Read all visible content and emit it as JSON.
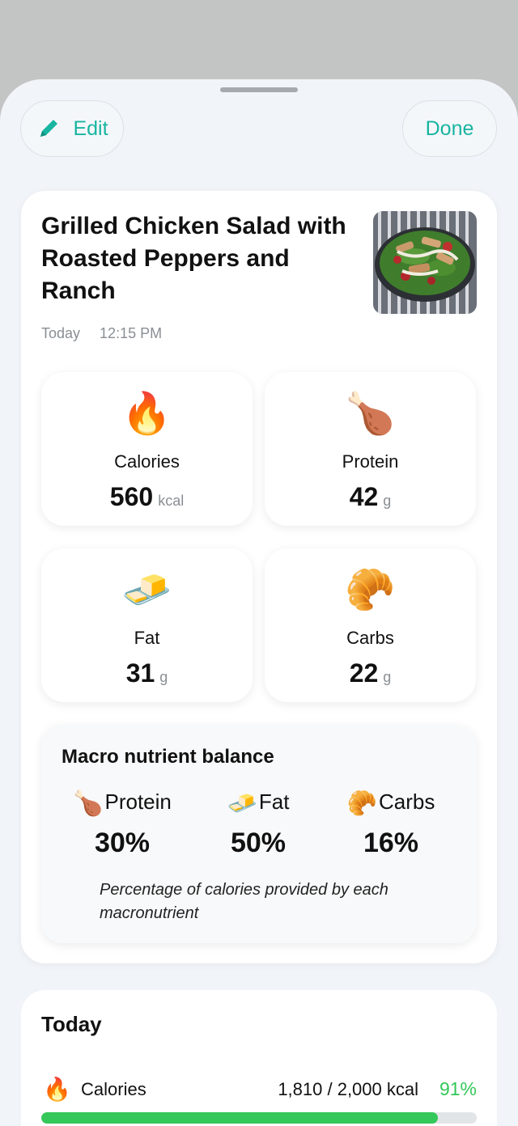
{
  "header": {
    "edit_label": "Edit",
    "done_label": "Done"
  },
  "meal": {
    "title": "Grilled Chicken Salad with Roasted Peppers and Ranch",
    "day": "Today",
    "time": "12:15 PM"
  },
  "stats": [
    {
      "icon": "fire-icon",
      "emoji": "🔥",
      "label": "Calories",
      "value": "560",
      "unit": "kcal"
    },
    {
      "icon": "poultry-leg-icon",
      "emoji": "🍗",
      "label": "Protein",
      "value": "42",
      "unit": "g"
    },
    {
      "icon": "butter-icon",
      "emoji": "🧈",
      "label": "Fat",
      "value": "31",
      "unit": "g"
    },
    {
      "icon": "croissant-icon",
      "emoji": "🥐",
      "label": "Carbs",
      "value": "22",
      "unit": "g"
    }
  ],
  "macro": {
    "title": "Macro nutrient balance",
    "items": [
      {
        "emoji": "🍗",
        "name": "Protein",
        "pct": "30%"
      },
      {
        "emoji": "🧈",
        "name": "Fat",
        "pct": "50%"
      },
      {
        "emoji": "🥐",
        "name": "Carbs",
        "pct": "16%"
      }
    ],
    "note": "Percentage of calories provided by each macronutrient"
  },
  "today": {
    "title": "Today",
    "calories": {
      "emoji": "🔥",
      "label": "Calories",
      "value": "1,810 / 2,000 kcal",
      "pct": "91%",
      "progress": 0.91
    }
  },
  "colors": {
    "accent": "#18b5a0",
    "progress": "#34c759",
    "background": "#f1f4f8"
  }
}
